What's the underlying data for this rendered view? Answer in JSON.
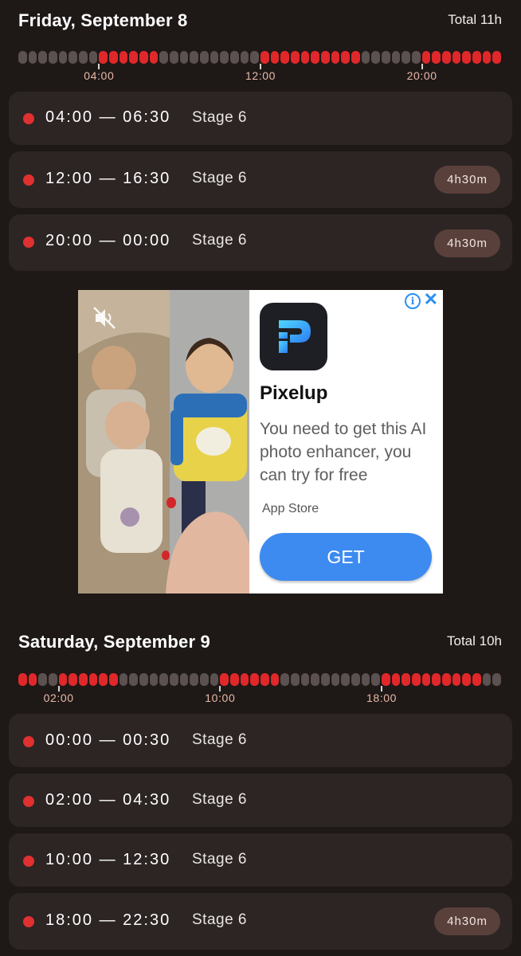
{
  "days": [
    {
      "title": "Friday, September 8",
      "total": "Total 11h",
      "timeline": {
        "ticks": [
          "04:00",
          "12:00",
          "20:00"
        ],
        "active_hours": [
          4,
          5,
          6,
          12,
          13,
          14,
          15,
          16,
          20,
          21,
          22,
          23
        ]
      },
      "slots": [
        {
          "time": "04:00 — 06:30",
          "stage": "Stage 6",
          "duration": ""
        },
        {
          "time": "12:00 — 16:30",
          "stage": "Stage 6",
          "duration": "4h30m"
        },
        {
          "time": "20:00 — 00:00",
          "stage": "Stage 6",
          "duration": "4h30m"
        }
      ]
    },
    {
      "title": "Saturday, September 9",
      "total": "Total 10h",
      "timeline": {
        "ticks": [
          "02:00",
          "10:00",
          "18:00"
        ],
        "active_hours": [
          0,
          2,
          3,
          4,
          10,
          11,
          12,
          18,
          19,
          20,
          21,
          22
        ]
      },
      "slots": [
        {
          "time": "00:00 — 00:30",
          "stage": "Stage 6",
          "duration": ""
        },
        {
          "time": "02:00 — 04:30",
          "stage": "Stage 6",
          "duration": ""
        },
        {
          "time": "10:00 — 12:30",
          "stage": "Stage 6",
          "duration": ""
        },
        {
          "time": "18:00 — 22:30",
          "stage": "Stage 6",
          "duration": "4h30m"
        }
      ]
    }
  ],
  "ad": {
    "app_name": "Pixelup",
    "description": "You need to get this AI photo enhancer, you can try for free",
    "store": "App Store",
    "cta": "GET",
    "info_icon": "info-icon",
    "close_icon": "close-icon",
    "mute_icon": "mute-icon"
  },
  "colors": {
    "background": "#1e1817",
    "card": "#2c2524",
    "active": "#e0282a",
    "inactive": "#5b5150",
    "badge": "#5a403b",
    "ad_button": "#3d8bf0"
  }
}
